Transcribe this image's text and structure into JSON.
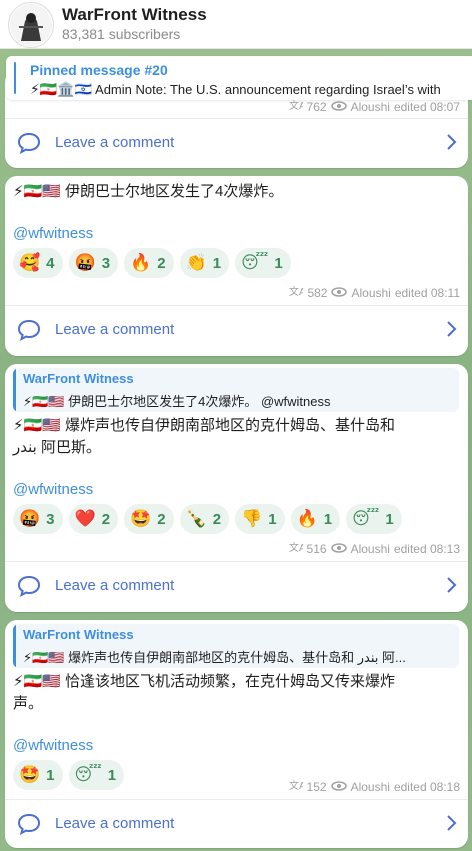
{
  "header": {
    "title": "WarFront Witness",
    "subscribers": "83,381 subscribers"
  },
  "pinned": {
    "title": "Pinned message #20",
    "prefix": "⚡🇮🇷🏛️🇮🇱",
    "text": "Admin Note: The U.S. announcement regarding Israel’s with"
  },
  "post0": {
    "views": "762",
    "author": "Aloushi",
    "edited": "edited 08:07",
    "comment": "Leave a comment"
  },
  "post1": {
    "text": "⚡🇮🇷🇺🇸 伊朗巴士尔地区发生了4次爆炸。",
    "handle": "@wfwitness",
    "reactions": [
      {
        "emoji": "🥰",
        "count": "4"
      },
      {
        "emoji": "🤬",
        "count": "3"
      },
      {
        "emoji": "🔥",
        "count": "2"
      },
      {
        "emoji": "👏",
        "count": "1"
      },
      {
        "emoji": "😴",
        "count": "1"
      }
    ],
    "views": "582",
    "author": "Aloushi",
    "edited": "edited 08:11",
    "comment": "Leave a comment"
  },
  "post2": {
    "quote_title": "WarFront Witness",
    "quote_text": "⚡🇮🇷🇺🇸 伊朗巴士尔地区发生了4次爆炸。 @wfwitness",
    "text_line1": "⚡🇮🇷🇺🇸 爆炸声也传自伊朗南部地区的克什姆岛、基什岛和",
    "text_line2": "بندر 阿巴斯。",
    "handle": "@wfwitness",
    "reactions": [
      {
        "emoji": "🤬",
        "count": "3"
      },
      {
        "emoji": "❤️",
        "count": "2"
      },
      {
        "emoji": "🤩",
        "count": "2"
      },
      {
        "emoji": "🍾",
        "count": "2"
      },
      {
        "emoji": "👎",
        "count": "1"
      },
      {
        "emoji": "🔥",
        "count": "1"
      },
      {
        "emoji": "😴",
        "count": "1"
      }
    ],
    "views": "516",
    "author": "Aloushi",
    "edited": "edited 08:13",
    "comment": "Leave a comment"
  },
  "post3": {
    "quote_title": "WarFront Witness",
    "quote_text": "⚡🇮🇷🇺🇸 爆炸声也传自伊朗南部地区的克什姆岛、基什岛和 بندر 阿...",
    "text_line1": "⚡🇮🇷🇺🇸 恰逢该地区飞机活动频繁，在克什姆岛又传来爆炸",
    "text_line2": "声。",
    "handle": "@wfwitness",
    "reactions": [
      {
        "emoji": "🤩",
        "count": "1"
      },
      {
        "emoji": "😴",
        "count": "1"
      }
    ],
    "views": "152",
    "author": "Aloushi",
    "edited": "edited 08:18",
    "comment": "Leave a comment"
  },
  "colors": {
    "accent": "#3d8fde",
    "comment": "#4b6fd0",
    "reaction_bg": "#eaf3ee"
  }
}
